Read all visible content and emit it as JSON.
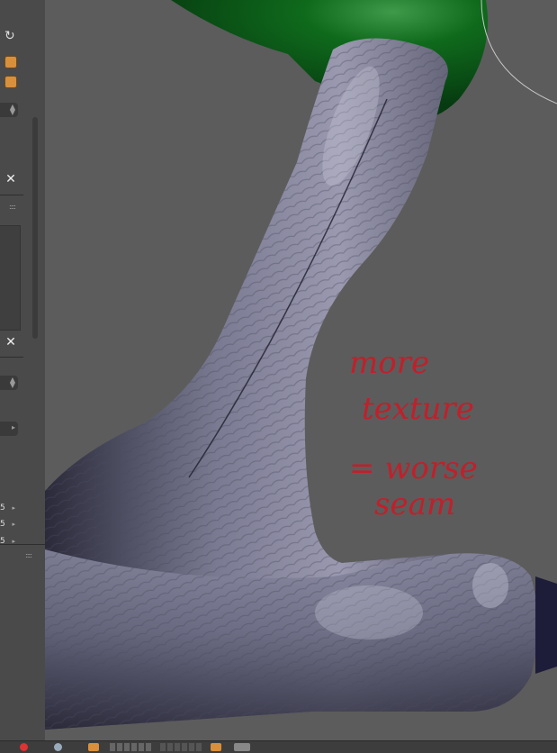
{
  "panel": {
    "refresh_icon": "refresh-icon",
    "number_rows": [
      "5",
      "5",
      "5"
    ]
  },
  "viewport": {
    "annotation": {
      "line1": "more",
      "line2": "texture",
      "line3": "= worse",
      "line4": "seam"
    },
    "colors": {
      "background": "#5c5c5c",
      "sphere": "#0f6a1c",
      "mesh": "#6d6c82",
      "annotation": "#c21f2a"
    }
  }
}
